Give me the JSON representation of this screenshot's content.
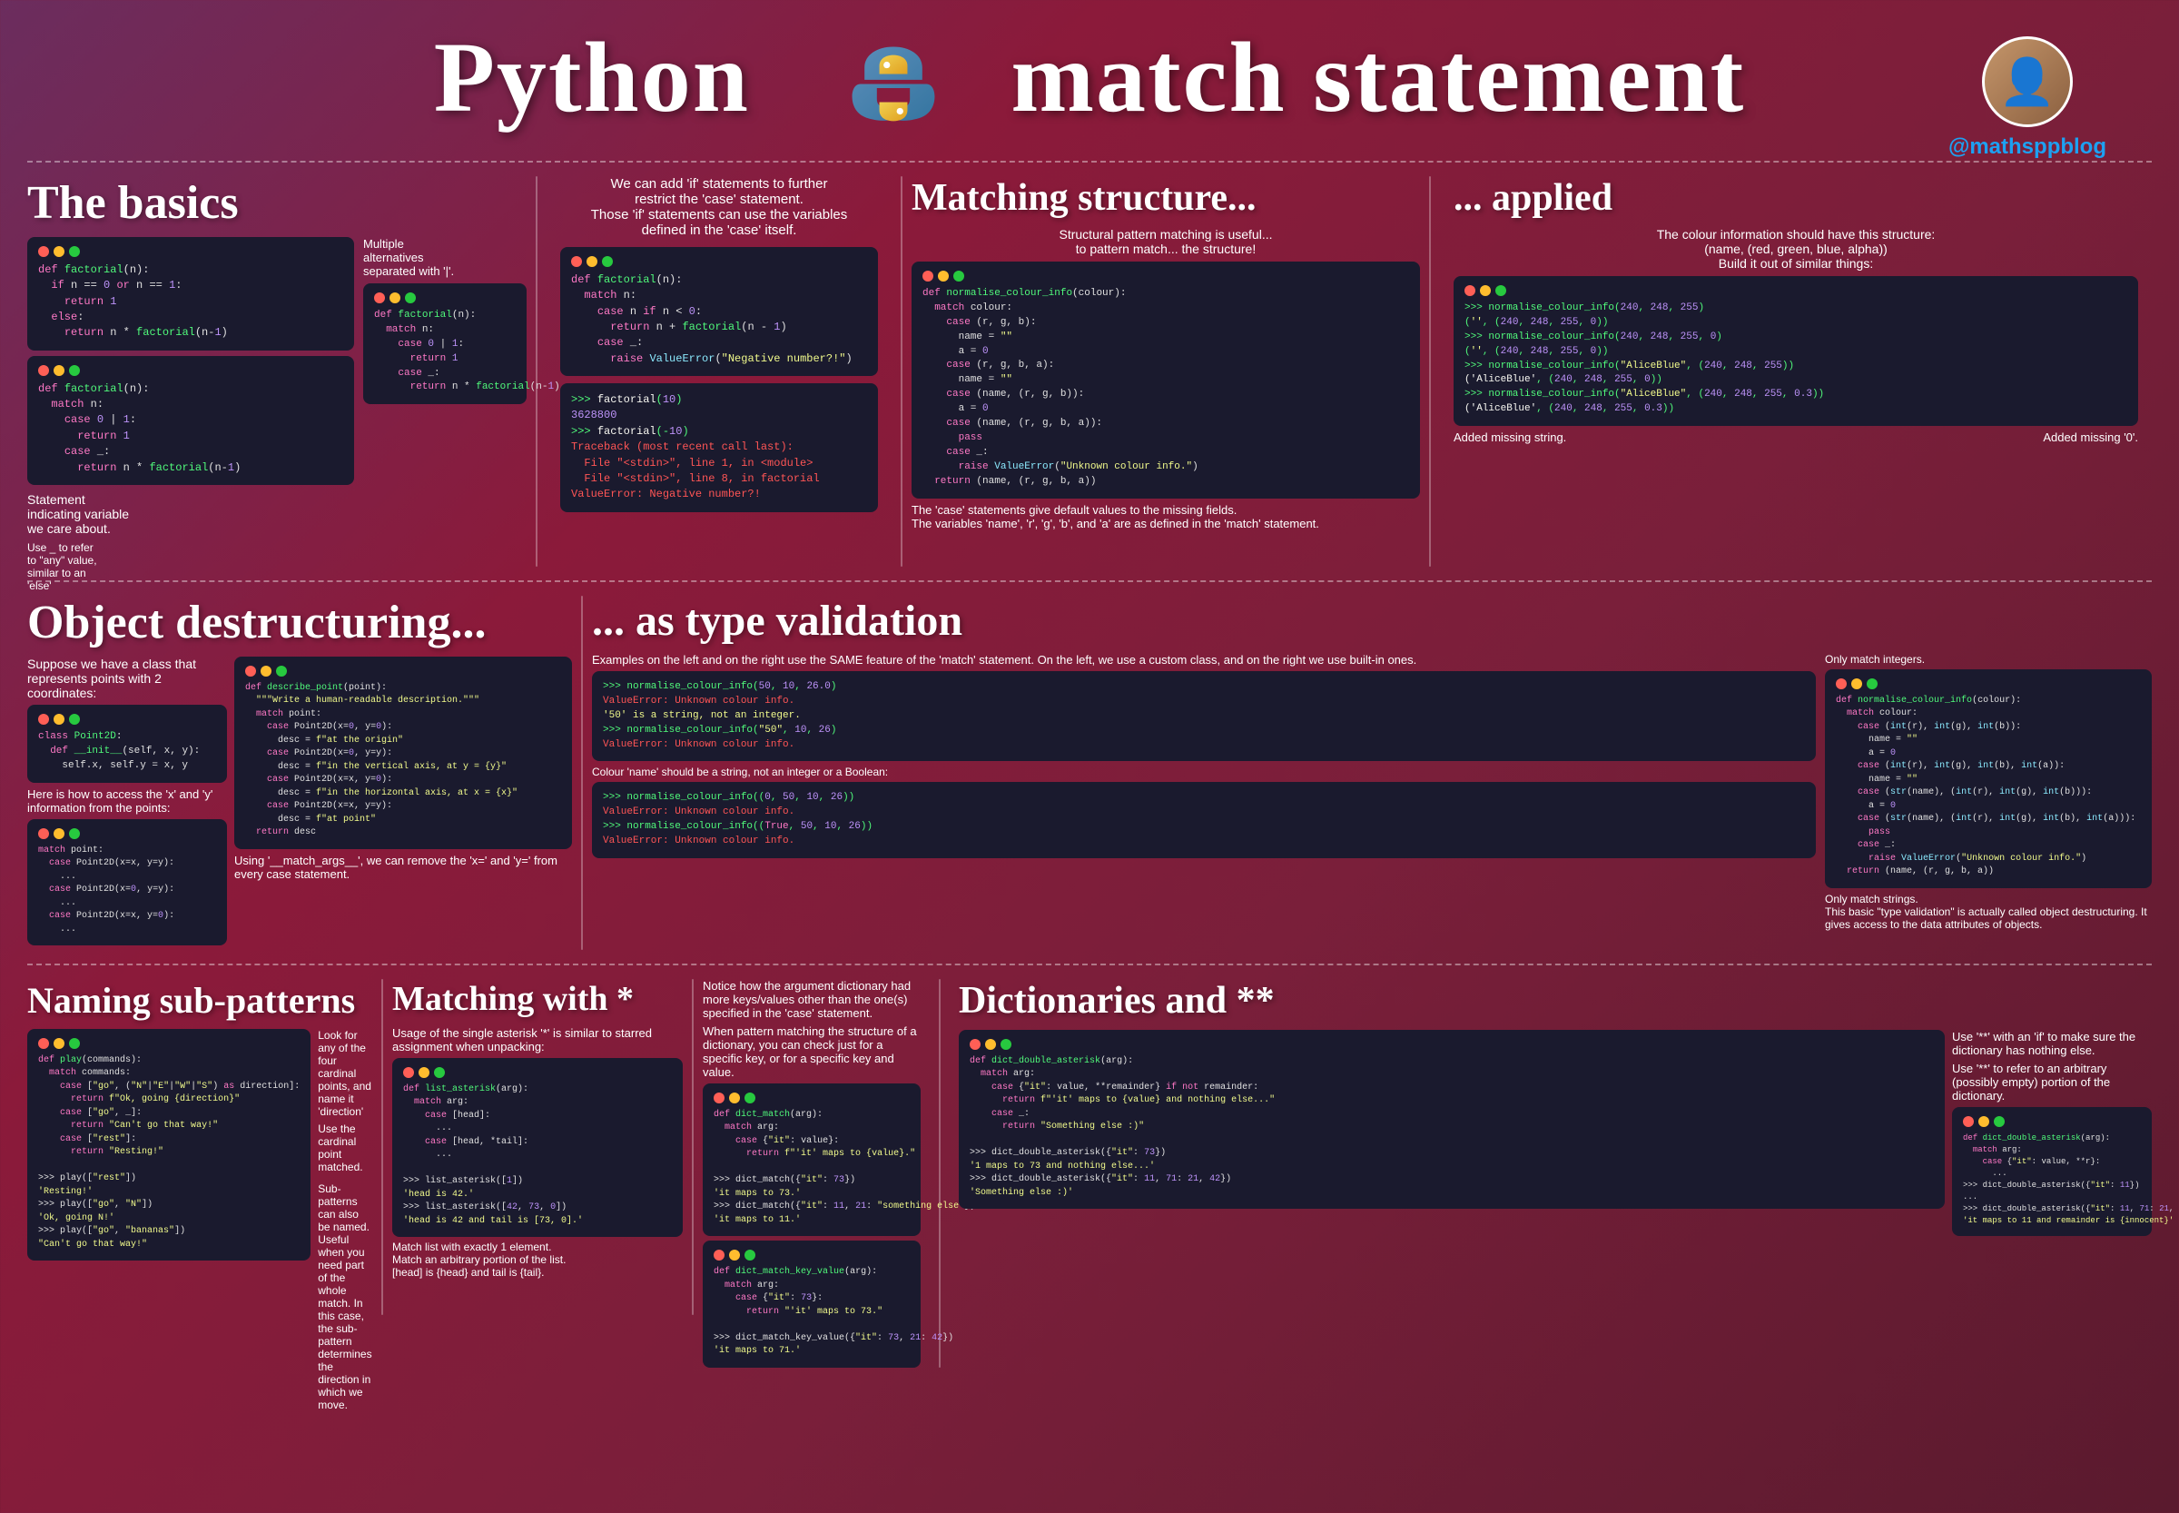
{
  "header": {
    "title_part1": "Python",
    "title_part2": "match statement",
    "twitter": "@mathsppblog"
  },
  "sections": {
    "basics": "The basics",
    "matching_structure": "Matching structure...",
    "applied": "... applied",
    "object_destructuring": "Object destructuring...",
    "type_validation": "... as type validation",
    "naming_subpatterns": "Naming sub-patterns",
    "matching_with_star": "Matching with *",
    "dictionaries": "Dictionaries and **"
  }
}
